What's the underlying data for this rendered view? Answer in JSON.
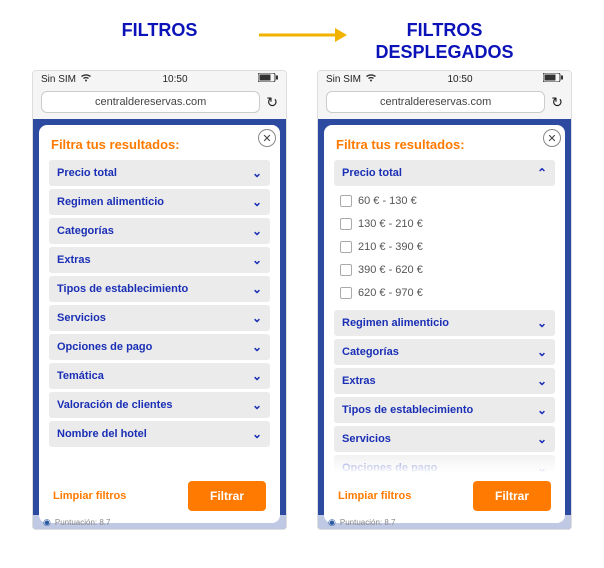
{
  "headings": {
    "left": "FILTROS",
    "right_l1": "FILTROS",
    "right_l2": "DESPLEGADOS"
  },
  "status": {
    "carrier": "Sin SIM",
    "time": "10:50"
  },
  "url": "centraldereservas.com",
  "panel_title": "Filtra tus resultados:",
  "filters": {
    "precio": "Precio total",
    "regimen": "Regimen alimenticio",
    "categorias": "Categorías",
    "extras": "Extras",
    "tipos": "Tipos de establecimiento",
    "servicios": "Servicios",
    "pago": "Opciones de pago",
    "tematica": "Temática",
    "valoracion": "Valoración de clientes",
    "nombre": "Nombre del hotel"
  },
  "price_options": [
    "60 € - 130 €",
    "130 € - 210 €",
    "210 € - 390 €",
    "390 € - 620 €",
    "620 € - 970 €"
  ],
  "buttons": {
    "clear": "Limpiar filtros",
    "apply": "Filtrar"
  },
  "bgstrip": "Puntuación: 8.7"
}
